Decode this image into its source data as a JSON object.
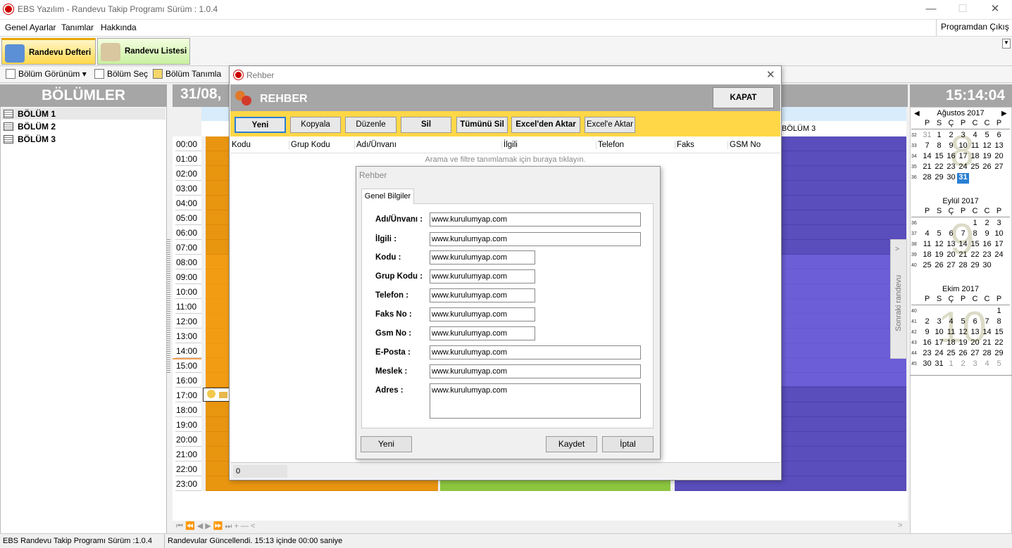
{
  "window": {
    "title": "EBS Yazılım - Randevu Takip Programı Sürüm : 1.0.4",
    "minimize": "—",
    "maximize": "☐",
    "close": "✕"
  },
  "menu": {
    "items": [
      "Genel Ayarlar",
      "Tanımlar",
      "Hakkında"
    ],
    "exit": "Programdan Çıkış"
  },
  "ribbon": {
    "tabs": [
      "Randevu Defteri",
      "Randevu Listesi"
    ]
  },
  "toolbar": {
    "items": [
      "Bölüm Görünüm ▾",
      "Bölüm Seç",
      "Bölüm Tanımla"
    ]
  },
  "left": {
    "header": "BÖLÜMLER",
    "items": [
      "BÖLÜM 1",
      "BÖLÜM 2",
      "BÖLÜM 3"
    ]
  },
  "main": {
    "date": "31/08,",
    "times": [
      "00:00",
      "01:00",
      "02:00",
      "03:00",
      "04:00",
      "05:00",
      "06:00",
      "07:00",
      "08:00",
      "09:00",
      "10:00",
      "11:00",
      "12:00",
      "13:00",
      "14:00",
      "15:00",
      "16:00",
      "17:00",
      "18:00",
      "19:00",
      "20:00",
      "21:00",
      "22:00",
      "23:00"
    ],
    "col3_label": "BÖLÜM 3",
    "next_appt": "Sonraki randevu",
    "nav": "⏮  ⏪  ◀  ▶  ⏩  ⏭  +  —  <"
  },
  "clock": "15:14:04",
  "calendar": {
    "days": [
      "P",
      "S",
      "Ç",
      "P",
      "C",
      "C",
      "P"
    ],
    "months": [
      {
        "title": "Ağustos 2017",
        "watermark": "8",
        "weeks": [
          {
            "n": "32",
            "d": [
              "31",
              "1",
              "2",
              "3",
              "4",
              "5",
              "6"
            ]
          },
          {
            "n": "33",
            "d": [
              "7",
              "8",
              "9",
              "10",
              "11",
              "12",
              "13"
            ]
          },
          {
            "n": "34",
            "d": [
              "14",
              "15",
              "16",
              "17",
              "18",
              "19",
              "20"
            ]
          },
          {
            "n": "35",
            "d": [
              "21",
              "22",
              "23",
              "24",
              "25",
              "26",
              "27"
            ]
          },
          {
            "n": "36",
            "d": [
              "28",
              "29",
              "30",
              "31",
              "",
              "",
              ""
            ]
          }
        ]
      },
      {
        "title": "Eylül 2017",
        "watermark": "9",
        "weeks": [
          {
            "n": "36",
            "d": [
              "",
              "",
              "",
              "",
              "1",
              "2",
              "3"
            ]
          },
          {
            "n": "37",
            "d": [
              "4",
              "5",
              "6",
              "7",
              "8",
              "9",
              "10"
            ]
          },
          {
            "n": "38",
            "d": [
              "11",
              "12",
              "13",
              "14",
              "15",
              "16",
              "17"
            ]
          },
          {
            "n": "39",
            "d": [
              "18",
              "19",
              "20",
              "21",
              "22",
              "23",
              "24"
            ]
          },
          {
            "n": "40",
            "d": [
              "25",
              "26",
              "27",
              "28",
              "29",
              "30",
              ""
            ]
          }
        ]
      },
      {
        "title": "Ekim 2017",
        "watermark": "10",
        "weeks": [
          {
            "n": "40",
            "d": [
              "",
              "",
              "",
              "",
              "",
              "",
              "1"
            ]
          },
          {
            "n": "41",
            "d": [
              "2",
              "3",
              "4",
              "5",
              "6",
              "7",
              "8"
            ]
          },
          {
            "n": "42",
            "d": [
              "9",
              "10",
              "11",
              "12",
              "13",
              "14",
              "15"
            ]
          },
          {
            "n": "43",
            "d": [
              "16",
              "17",
              "18",
              "19",
              "20",
              "21",
              "22"
            ]
          },
          {
            "n": "44",
            "d": [
              "23",
              "24",
              "25",
              "26",
              "27",
              "28",
              "29"
            ]
          },
          {
            "n": "45",
            "d": [
              "30",
              "31",
              "1",
              "2",
              "3",
              "4",
              "5"
            ]
          }
        ]
      }
    ]
  },
  "status": {
    "left": "EBS Randevu Takip  Programı Sürüm :1.0.4",
    "right": "Randevular Güncellendi. 15:13  içinde 00:00 saniye"
  },
  "rehber": {
    "title": "Rehber",
    "header": "REHBER",
    "close": "KAPAT",
    "buttons": [
      "Yeni",
      "Kopyala",
      "Düzenle",
      "Sil",
      "Tümünü Sil",
      "Excel'den Aktar",
      "Excel'e Aktar"
    ],
    "columns": [
      "Kodu",
      "Grup Kodu",
      "Adı/Ünvanı",
      "İlgili",
      "Telefon",
      "Faks",
      "GSM No"
    ],
    "filter": "Arama ve filtre tanımlamak için buraya tıklayın.",
    "count": "0"
  },
  "form": {
    "title": "Rehber",
    "tab": "Genel Bilgiler",
    "fields": [
      {
        "label": "Adı/Ünvanı :",
        "value": "www.kurulumyap.com"
      },
      {
        "label": "İlgili :",
        "value": "www.kurulumyap.com"
      },
      {
        "label": "Kodu :",
        "value": "www.kurulumyap.com"
      },
      {
        "label": "Grup Kodu :",
        "value": "www.kurulumyap.com"
      },
      {
        "label": "Telefon :",
        "value": "www.kurulumyap.com"
      },
      {
        "label": "Faks No :",
        "value": "www.kurulumyap.com"
      },
      {
        "label": "Gsm No :",
        "value": "www.kurulumyap.com"
      },
      {
        "label": "E-Posta :",
        "value": "www.kurulumyap.com"
      },
      {
        "label": "Meslek :",
        "value": "www.kurulumyap.com"
      },
      {
        "label": "Adres :",
        "value": "www.kurulumyap.com"
      }
    ],
    "buttons": {
      "new": "Yeni",
      "save": "Kaydet",
      "cancel": "İptal"
    }
  }
}
